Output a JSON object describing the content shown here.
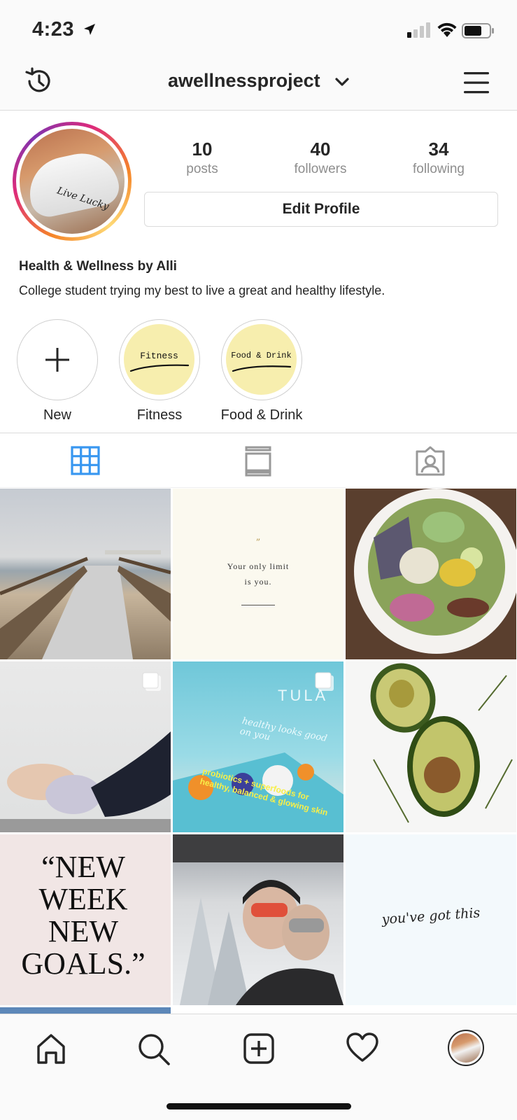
{
  "status_bar": {
    "time": "4:23"
  },
  "header": {
    "username": "awellnessproject"
  },
  "profile": {
    "avatar_cap_text": "Live Lucky",
    "stats": [
      {
        "value": "10",
        "label": "posts"
      },
      {
        "value": "40",
        "label": "followers"
      },
      {
        "value": "34",
        "label": "following"
      }
    ],
    "edit_button": "Edit Profile",
    "name": "Health & Wellness by Alli",
    "bio": "College student trying my best to live a great and healthy lifestyle."
  },
  "highlights": [
    {
      "label": "New",
      "cover_text": ""
    },
    {
      "label": "Fitness",
      "cover_text": "Fitness"
    },
    {
      "label": "Food & Drink",
      "cover_text": "Food & Drink"
    }
  ],
  "grid": {
    "quote_post": {
      "line1": "Your only limit",
      "line2": "is you."
    },
    "tula_post": {
      "brand": "TULA",
      "tagline": "healthy looks good on you",
      "line": "probiotics + superfoods for healthy, balanced & glowing skin"
    },
    "goals_post": {
      "line1": "“NEW",
      "line2": "WEEK",
      "line3": "NEW",
      "line4": "GOALS.”"
    },
    "gotthis_post": {
      "text": "you've got this"
    }
  },
  "colors": {
    "active_tab": "#3897f0",
    "muted": "#8e8e8e",
    "border": "#dbdbdb",
    "highlight_cover": "#f7eeae"
  }
}
